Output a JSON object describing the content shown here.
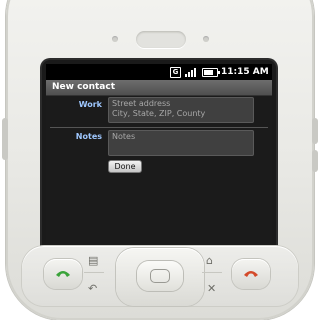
{
  "status_bar": {
    "g_badge": "G",
    "signal_icon": "signal-icon",
    "battery_icon": "battery-icon",
    "time": "11:15 AM"
  },
  "title_bar": {
    "title": "New contact"
  },
  "form": {
    "work": {
      "label": "Work",
      "street_placeholder": "Street address",
      "city_placeholder": "City, State, ZIP, County"
    },
    "notes": {
      "label": "Notes",
      "placeholder": "Notes"
    },
    "done_label": "Done"
  },
  "hardware": {
    "call_icon": "call-icon",
    "end_call_icon": "end-call-icon",
    "menu_icon": "menu-icon",
    "back_icon": "back-icon",
    "home_icon": "home-icon",
    "search_icon": "search-icon"
  },
  "colors": {
    "label_color": "#9fc8ff",
    "call_green": "#3aa33a",
    "end_red": "#d44a2a"
  }
}
